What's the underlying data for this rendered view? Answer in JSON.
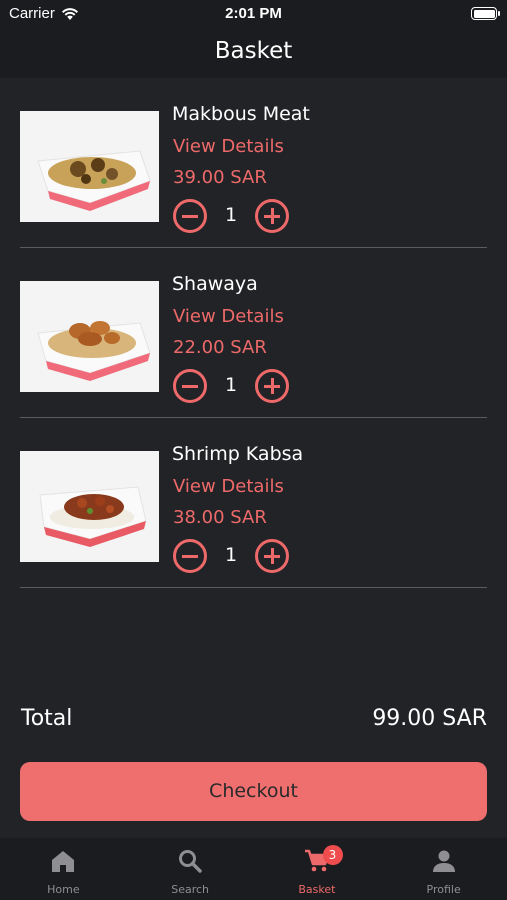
{
  "status_bar": {
    "carrier": "Carrier",
    "time": "2:01 PM"
  },
  "header": {
    "title": "Basket"
  },
  "items": [
    {
      "name": "Makbous Meat",
      "details_label": "View Details",
      "price": "39.00 SAR",
      "quantity": "1"
    },
    {
      "name": "Shawaya",
      "details_label": "View Details",
      "price": "22.00 SAR",
      "quantity": "1"
    },
    {
      "name": "Shrimp Kabsa",
      "details_label": "View Details",
      "price": "38.00 SAR",
      "quantity": "1"
    }
  ],
  "summary": {
    "total_label": "Total",
    "total_value": "99.00 SAR"
  },
  "checkout_label": "Checkout",
  "tabs": [
    {
      "label": "Home",
      "icon": "home-icon"
    },
    {
      "label": "Search",
      "icon": "search-icon"
    },
    {
      "label": "Basket",
      "icon": "cart-icon",
      "badge": "3",
      "active": true
    },
    {
      "label": "Profile",
      "icon": "person-icon"
    }
  ],
  "colors": {
    "background": "#222326",
    "bar": "#1b1c1f",
    "accent": "#ee6a6a",
    "button": "#ef6f6f",
    "inactive": "#8e8e93"
  }
}
